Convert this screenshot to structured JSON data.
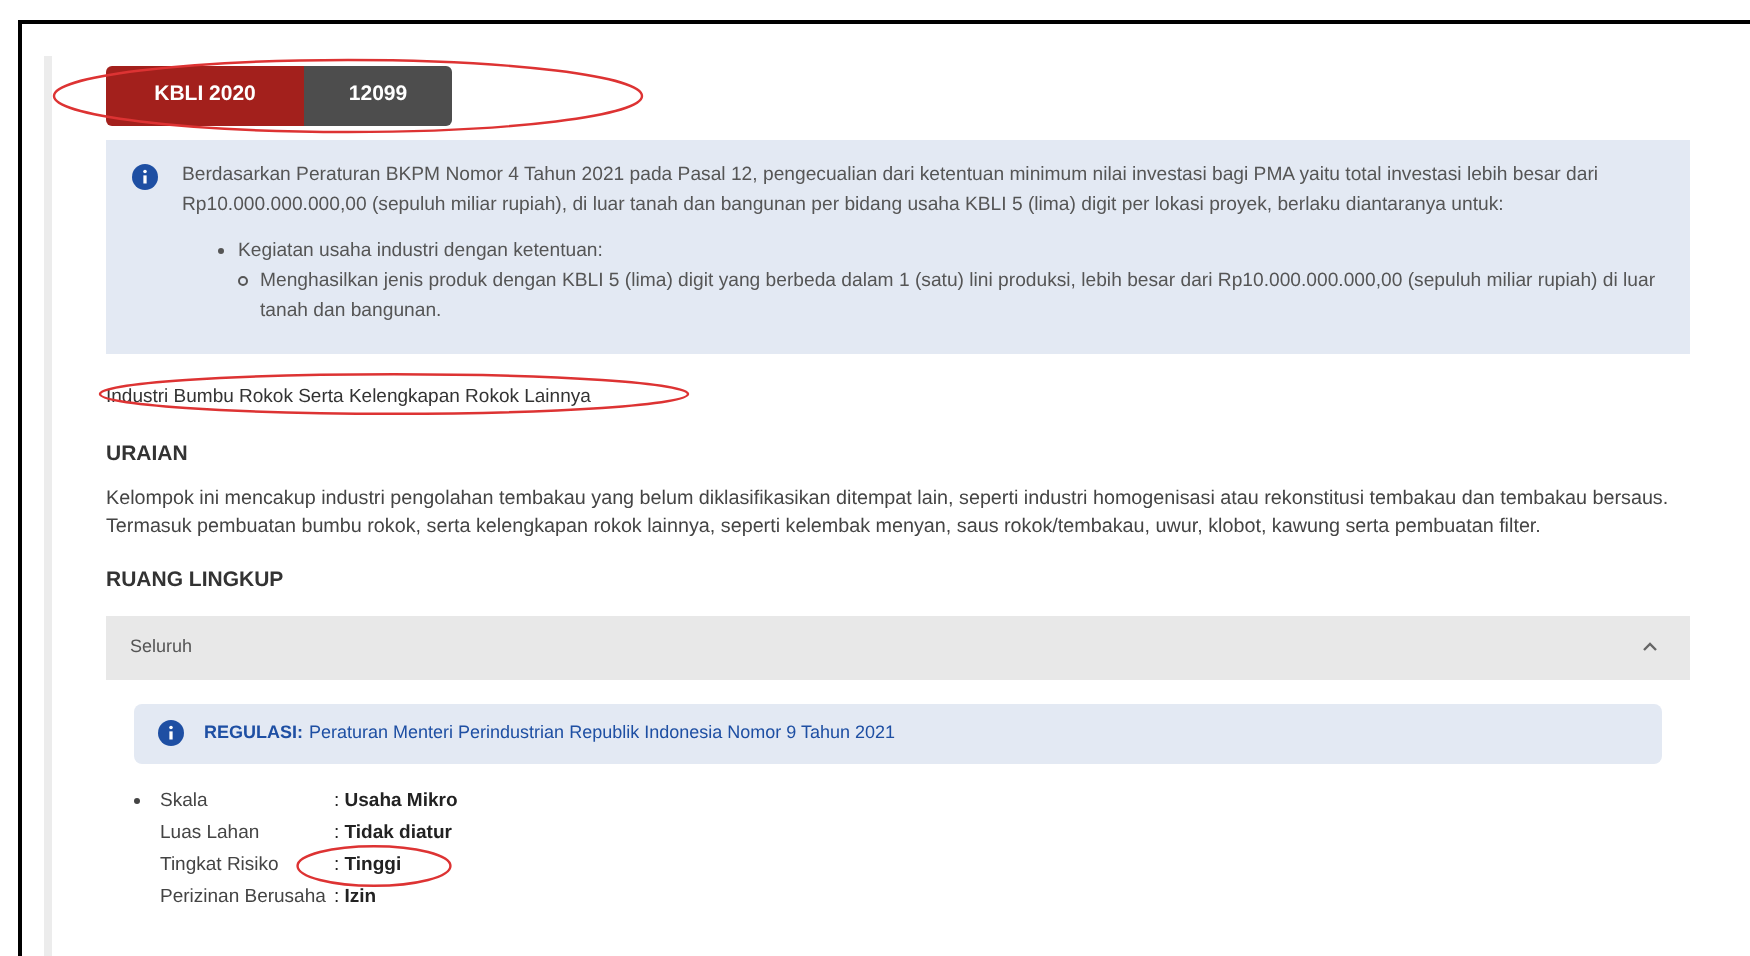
{
  "badge": {
    "label": "KBLI 2020",
    "code": "12099"
  },
  "notice": {
    "text": "Berdasarkan Peraturan BKPM Nomor 4 Tahun 2021 pada Pasal 12, pengecualian dari ketentuan minimum nilai investasi bagi PMA yaitu total investasi lebih besar dari Rp10.000.000.000,00 (sepuluh miliar rupiah), di luar tanah dan bangunan per bidang usaha KBLI 5 (lima) digit per lokasi proyek, berlaku diantaranya untuk:",
    "items": [
      {
        "text": "Kegiatan usaha industri dengan ketentuan:",
        "children": [
          {
            "text": "Menghasilkan jenis produk dengan KBLI 5 (lima) digit yang berbeda dalam 1 (satu) lini produksi, lebih besar dari Rp10.000.000.000,00 (sepuluh miliar rupiah) di luar tanah dan bangunan."
          }
        ]
      }
    ]
  },
  "title": "Industri Bumbu Rokok Serta Kelengkapan Rokok Lainnya",
  "description": {
    "heading": "URAIAN",
    "text": "Kelompok ini mencakup industri pengolahan tembakau yang belum diklasifikasikan ditempat lain, seperti industri homogenisasi atau rekonstitusi tembakau dan tembakau bersaus. Termasuk pembuatan bumbu rokok, serta kelengkapan rokok lainnya, seperti kelembak menyan, saus rokok/tembakau, uwur, klobot, kawung serta pembuatan filter."
  },
  "scope": {
    "heading": "RUANG LINGKUP",
    "accordion": {
      "label": "Seluruh",
      "expanded": true,
      "regulation": {
        "label": "REGULASI:",
        "text": "Peraturan Menteri Perindustrian Republik Indonesia Nomor 9 Tahun 2021"
      },
      "details": [
        {
          "label": "Skala",
          "value": ": **Usaha Mikro**"
        },
        {
          "label": "Luas Lahan",
          "value": ": **Tidak diatur**"
        },
        {
          "label": "Tingkat Risiko",
          "value": ": **Tinggi**"
        },
        {
          "label": "Perizinan Berusaha",
          "value": ": **Izin**"
        }
      ]
    }
  }
}
